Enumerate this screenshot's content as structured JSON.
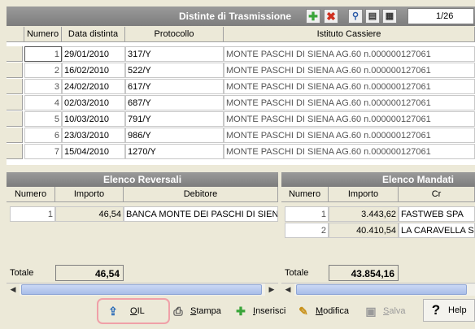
{
  "top_panel": {
    "title": "Distinte di Trasmissione",
    "counter": "1/26",
    "columns": [
      "Numero",
      "Data distinta",
      "Protocollo",
      "Istituto Cassiere"
    ],
    "rows": [
      {
        "numero": "1",
        "data": "29/01/2010",
        "protocollo": "317/Y",
        "istituto": "MONTE  PASCHI DI SIENA AG.60  n.000000127061"
      },
      {
        "numero": "2",
        "data": "16/02/2010",
        "protocollo": "522/Y",
        "istituto": "MONTE  PASCHI DI SIENA AG.60  n.000000127061"
      },
      {
        "numero": "3",
        "data": "24/02/2010",
        "protocollo": "617/Y",
        "istituto": "MONTE  PASCHI DI SIENA AG.60  n.000000127061"
      },
      {
        "numero": "4",
        "data": "02/03/2010",
        "protocollo": "687/Y",
        "istituto": "MONTE  PASCHI DI SIENA AG.60  n.000000127061"
      },
      {
        "numero": "5",
        "data": "10/03/2010",
        "protocollo": "791/Y",
        "istituto": "MONTE  PASCHI DI SIENA AG.60  n.000000127061"
      },
      {
        "numero": "6",
        "data": "23/03/2010",
        "protocollo": "986/Y",
        "istituto": "MONTE  PASCHI DI SIENA AG.60  n.000000127061"
      },
      {
        "numero": "7",
        "data": "15/04/2010",
        "protocollo": "1270/Y",
        "istituto": "MONTE  PASCHI DI SIENA AG.60  n.000000127061"
      }
    ]
  },
  "reversali": {
    "title": "Elenco Reversali",
    "columns": [
      "Numero",
      "Importo",
      "Debitore"
    ],
    "rows": [
      {
        "numero": "1",
        "importo": "46,54",
        "debitore": "BANCA MONTE DEI PASCHI DI SIENA S"
      }
    ],
    "total_label": "Totale",
    "total_value": "46,54"
  },
  "mandati": {
    "title": "Elenco Mandati",
    "columns": [
      "Numero",
      "Importo",
      "Cr"
    ],
    "rows": [
      {
        "numero": "1",
        "importo": "3.443,62",
        "creditore": "FASTWEB SPA"
      },
      {
        "numero": "2",
        "importo": "40.410,54",
        "creditore": "LA CARAVELLA SR"
      }
    ],
    "total_label": "Totale",
    "total_value": "43.854,16"
  },
  "toolbar": {
    "oil": {
      "first": "O",
      "rest": "IL"
    },
    "stampa": {
      "first": "S",
      "rest": "tampa"
    },
    "inserisci": {
      "first": "I",
      "rest": "nserisci"
    },
    "modifica": {
      "first": "M",
      "rest": "odifica"
    },
    "salva": {
      "first": "S",
      "rest": "alva"
    },
    "help": "Help"
  },
  "colors": {
    "title_bar": "#8c8c8c",
    "highlight_ring": "#f0a0a8",
    "add_green": "#3aa53a",
    "delete_red": "#d03020"
  }
}
